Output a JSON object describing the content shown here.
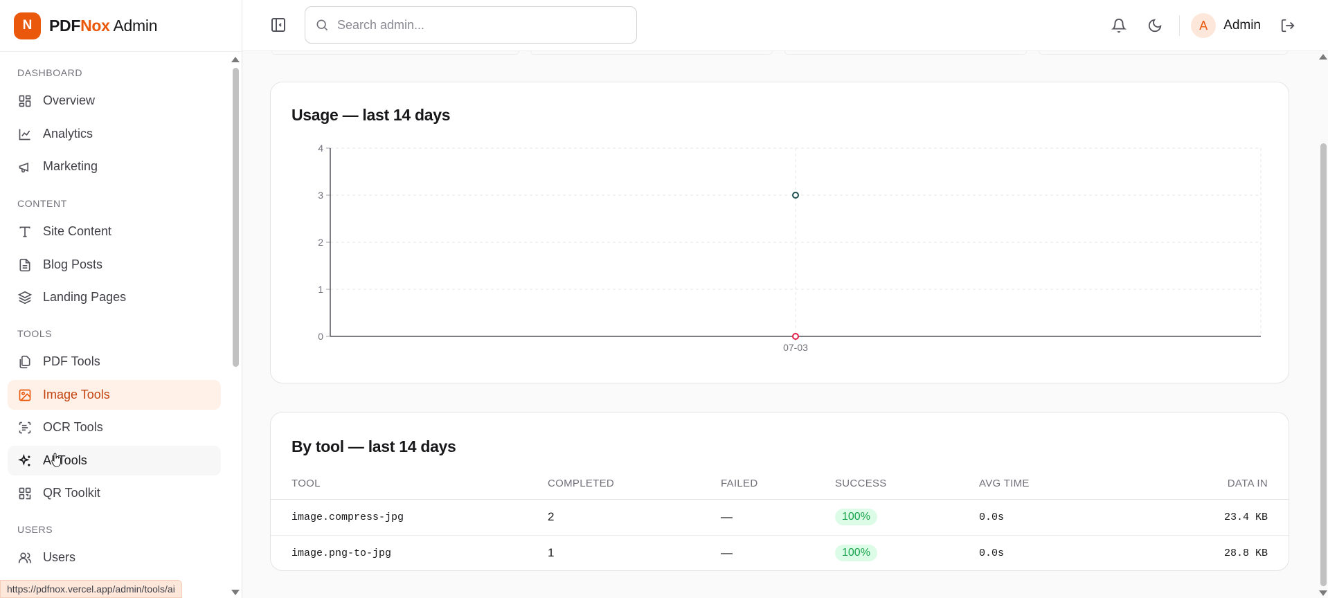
{
  "brand": {
    "logo_letter": "N",
    "name_part1": "PDF",
    "name_accent": "Nox",
    "name_part2": " Admin",
    "accent_color": "#ea580c"
  },
  "sidebar": {
    "sections": [
      {
        "label": "DASHBOARD",
        "items": [
          {
            "label": "Overview",
            "icon": "grid-icon"
          },
          {
            "label": "Analytics",
            "icon": "line-chart-icon"
          },
          {
            "label": "Marketing",
            "icon": "megaphone-icon"
          }
        ]
      },
      {
        "label": "CONTENT",
        "items": [
          {
            "label": "Site Content",
            "icon": "text-icon"
          },
          {
            "label": "Blog Posts",
            "icon": "document-icon"
          },
          {
            "label": "Landing Pages",
            "icon": "layers-icon"
          }
        ]
      },
      {
        "label": "TOOLS",
        "items": [
          {
            "label": "PDF Tools",
            "icon": "files-icon"
          },
          {
            "label": "Image Tools",
            "icon": "image-icon",
            "active": true
          },
          {
            "label": "OCR Tools",
            "icon": "scan-text-icon"
          },
          {
            "label": "AI Tools",
            "icon": "sparkles-icon",
            "hover": true
          },
          {
            "label": "QR Toolkit",
            "icon": "qr-code-icon"
          }
        ]
      },
      {
        "label": "USERS",
        "items": [
          {
            "label": "Users",
            "icon": "users-icon"
          }
        ]
      }
    ]
  },
  "status_url": "https://pdfnox.vercel.app/admin/tools/ai",
  "header": {
    "search_placeholder": "Search admin...",
    "user_initial": "A",
    "user_name": "Admin"
  },
  "usage_card": {
    "title": "Usage — last 14 days"
  },
  "chart_data": {
    "type": "line",
    "title": "Usage — last 14 days",
    "xlabel": "",
    "ylabel": "",
    "x": [
      "07-03"
    ],
    "ylim": [
      0,
      4
    ],
    "yticks": [
      0,
      1,
      2,
      3,
      4
    ],
    "grid": true,
    "series": [
      {
        "values": [
          3
        ],
        "color": "#1f4f4f"
      },
      {
        "values": [
          0
        ],
        "color": "#e11d48"
      }
    ]
  },
  "tool_card": {
    "title": "By tool — last 14 days",
    "columns": [
      "TOOL",
      "COMPLETED",
      "FAILED",
      "SUCCESS",
      "AVG TIME",
      "DATA IN"
    ],
    "rows": [
      {
        "tool": "image.compress-jpg",
        "completed": "2",
        "failed": "—",
        "success": "100%",
        "avg_time": "0.0s",
        "data_in": "23.4 KB"
      },
      {
        "tool": "image.png-to-jpg",
        "completed": "1",
        "failed": "—",
        "success": "100%",
        "avg_time": "0.0s",
        "data_in": "28.8 KB"
      }
    ]
  }
}
